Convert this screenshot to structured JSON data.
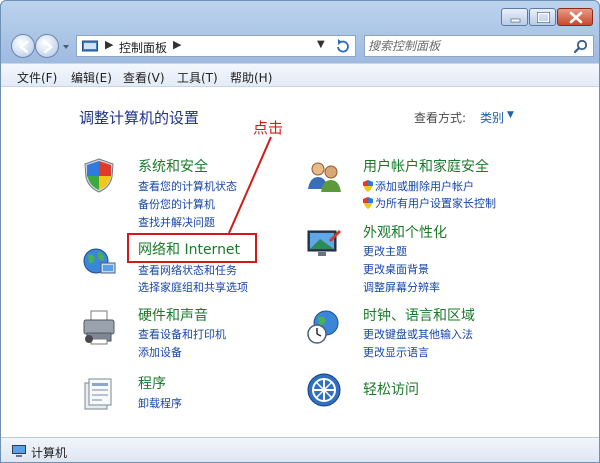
{
  "address": {
    "crumb": "控制面板",
    "search_placeholder": "搜索控制面板"
  },
  "menu": [
    "文件(F)",
    "编辑(E)",
    "查看(V)",
    "工具(T)",
    "帮助(H)"
  ],
  "main": {
    "title": "调整计算机的设置",
    "view_by_label": "查看方式:",
    "view_by_value": "类别"
  },
  "annotation": "点击",
  "categories": [
    {
      "title": "系统和安全",
      "links": [
        "查看您的计算机状态",
        "备份您的计算机",
        "查找并解决问题"
      ]
    },
    {
      "title": "网络和 Internet",
      "links": [
        "查看网络状态和任务",
        "选择家庭组和共享选项"
      ]
    },
    {
      "title": "硬件和声音",
      "links": [
        "查看设备和打印机",
        "添加设备"
      ]
    },
    {
      "title": "程序",
      "links": [
        "卸载程序"
      ]
    },
    {
      "title": "用户帐户和家庭安全",
      "links": [
        "添加或删除用户帐户",
        "为所有用户设置家长控制"
      ]
    },
    {
      "title": "外观和个性化",
      "links": [
        "更改主题",
        "更改桌面背景",
        "调整屏幕分辨率"
      ]
    },
    {
      "title": "时钟、语言和区域",
      "links": [
        "更改键盘或其他输入法",
        "更改显示语言"
      ]
    },
    {
      "title": "轻松访问",
      "links": []
    }
  ],
  "status": "计算机",
  "colors": {
    "category_title": "#1a7a2a",
    "link": "#1646a8",
    "annotation": "#d21a1a"
  }
}
